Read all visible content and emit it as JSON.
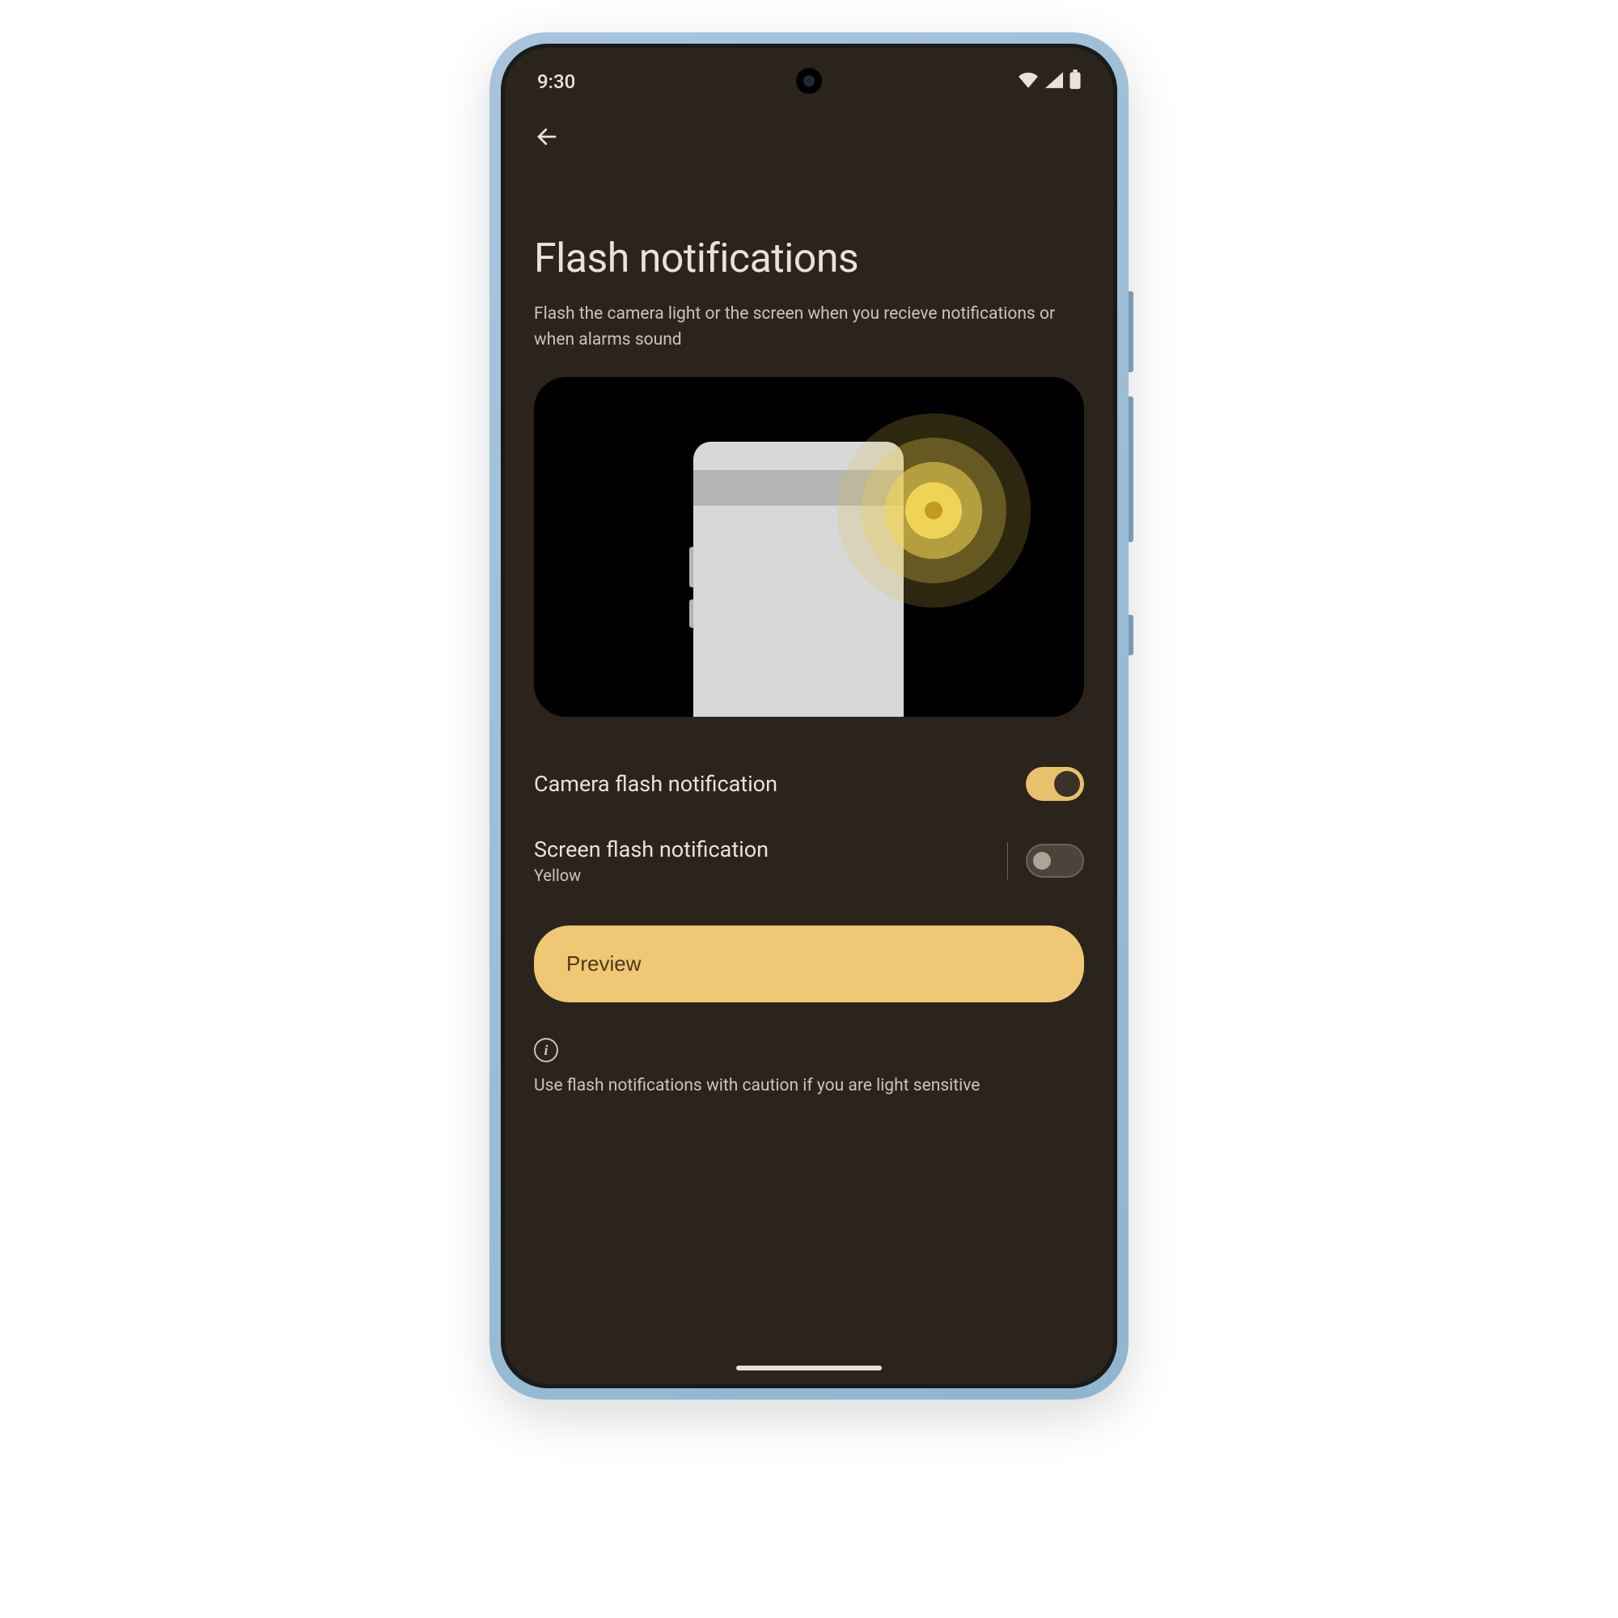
{
  "status": {
    "time": "9:30"
  },
  "page": {
    "title": "Flash notifications",
    "subtitle": "Flash the camera light or the screen when you recieve notifications or when alarms sound"
  },
  "settings": {
    "camera_flash": {
      "label": "Camera flash notification",
      "enabled": true
    },
    "screen_flash": {
      "label": "Screen flash notification",
      "sub": "Yellow",
      "enabled": false
    }
  },
  "preview_button": "Preview",
  "info": {
    "text": "Use flash notifications with caution if you are light sensitive"
  },
  "colors": {
    "accent": "#e9c06b",
    "background": "#2a241c"
  }
}
